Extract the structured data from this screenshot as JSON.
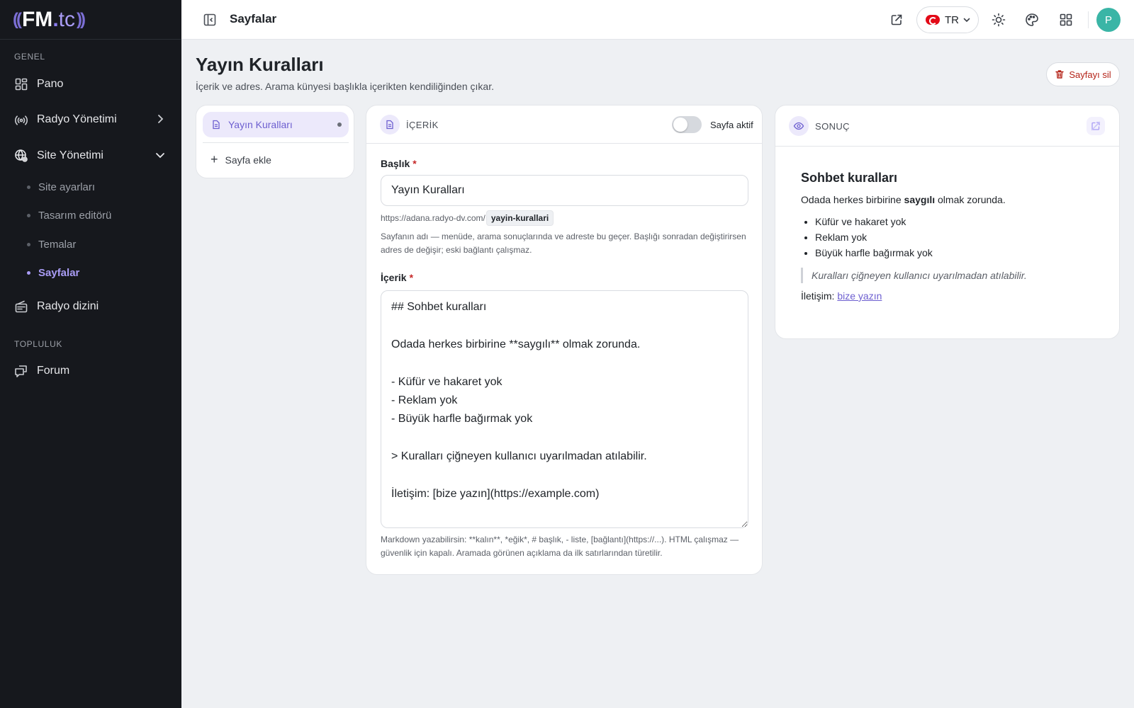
{
  "sidebar": {
    "logo": {
      "wave_left": "((",
      "brand": "FM",
      "dot": ".",
      "tld": "tc",
      "wave_right": "))"
    },
    "sections": [
      {
        "label": "GENEL"
      },
      {
        "label": "TOPLULUK"
      }
    ],
    "items": [
      {
        "label": "Pano",
        "icon": "dashboard-icon"
      },
      {
        "label": "Radyo Yönetimi",
        "icon": "broadcast-icon"
      },
      {
        "label": "Site Yönetimi",
        "icon": "globe-settings-icon"
      },
      {
        "label": "Radyo dizini",
        "icon": "radio-icon"
      },
      {
        "label": "Forum",
        "icon": "forum-icon"
      }
    ],
    "subitems": [
      "Site ayarları",
      "Tasarım editörü",
      "Temalar",
      "Sayfalar"
    ],
    "active_subitem": "Sayfalar"
  },
  "topbar": {
    "title": "Sayfalar",
    "language": "TR",
    "avatar_initial": "P"
  },
  "page": {
    "title": "Yayın Kuralları",
    "subtitle": "İçerik ve adres. Arama künyesi başlıkla içerikten kendiliğinden çıkar.",
    "delete_label": "Sayfayı sil"
  },
  "pages_list": {
    "items": [
      "Yayın Kuralları"
    ],
    "add_label": "Sayfa ekle"
  },
  "editor": {
    "header": "İÇERİK",
    "active_label": "Sayfa aktif",
    "active": false,
    "title_label": "Başlık",
    "title_value": "Yayın Kuralları",
    "url_base": "https://adana.radyo-dv.com/",
    "slug": "yayin-kurallari",
    "title_help": "Sayfanın adı — menüde, arama sonuçlarında ve adreste bu geçer. Başlığı sonradan değiştirirsen adres de değişir; eski bağlantı çalışmaz.",
    "content_label": "İçerik",
    "content_value": "## Sohbet kuralları\n\nOdada herkes birbirine **saygılı** olmak zorunda.\n\n- Küfür ve hakaret yok\n- Reklam yok\n- Büyük harfle bağırmak yok\n\n> Kuralları çiğneyen kullanıcı uyarılmadan atılabilir.\n\nİletişim: [bize yazın](https://example.com)",
    "content_help": "Markdown yazabilirsin: **kalın**, *eğik*, # başlık, - liste, [bağlantı](https://...). HTML çalışmaz — güvenlik için kapalı. Aramada görünen açıklama da ilk satırlarından türetilir."
  },
  "preview": {
    "header": "SONUÇ",
    "heading": "Sohbet kuralları",
    "para_before": "Odada herkes birbirine ",
    "para_bold": "saygılı",
    "para_after": " olmak zorunda.",
    "list": [
      "Küfür ve hakaret yok",
      "Reklam yok",
      "Büyük harfle bağırmak yok"
    ],
    "quote": "Kuralları çiğneyen kullanıcı uyarılmadan atılabilir.",
    "contact_label": "İletişim: ",
    "contact_link": "bize yazın"
  },
  "colors": {
    "accent": "#6d5fd0",
    "sidebar_bg": "#16181d",
    "danger": "#b42318",
    "avatar": "#3ab5a6"
  }
}
